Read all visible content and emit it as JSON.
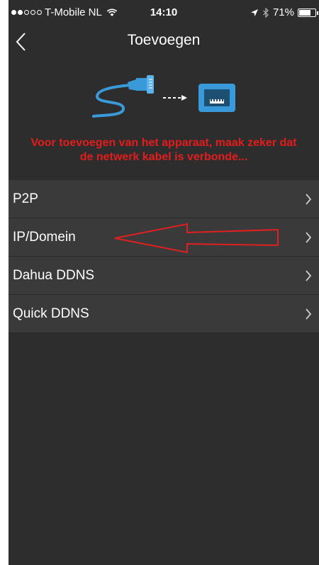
{
  "status_bar": {
    "carrier": "T-Mobile NL",
    "time": "14:10",
    "battery": "71%",
    "battery_level": 0.71
  },
  "nav": {
    "title": "Toevoegen"
  },
  "warning_text": "Voor toevoegen van het apparaat, maak zeker dat de netwerk kabel is verbonde...",
  "menu": [
    {
      "label": "P2P"
    },
    {
      "label": "IP/Domein"
    },
    {
      "label": "Dahua DDNS"
    },
    {
      "label": "Quick DDNS"
    }
  ],
  "colors": {
    "background": "#2d2d2d",
    "row_background": "#3a3a3a",
    "warning": "#e41c1c",
    "cable_blue": "#3a9ad9",
    "annotation": "#e02020"
  },
  "icons": {
    "back": "chevron-left-icon",
    "row": "chevron-right-icon",
    "illustration": "ethernet-cable-to-port"
  },
  "annotation": {
    "type": "arrow",
    "points_to": "IP/Domein"
  }
}
